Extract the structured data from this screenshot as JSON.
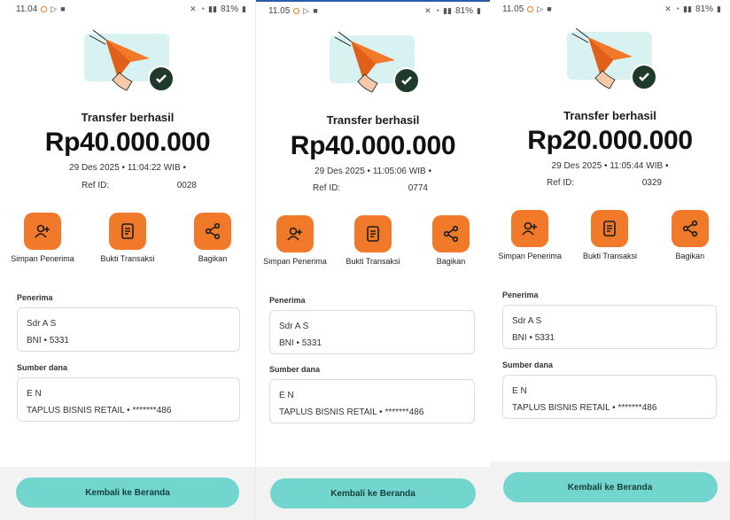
{
  "accent_color": "#f07a2a",
  "button_color": "#72d6cf",
  "screens": [
    {
      "status_time": "11.04",
      "battery": "81%",
      "title": "Transfer berhasil",
      "amount": "Rp40.000.000",
      "datetime": "29 Des 2025 • 11:04:22 WIB •",
      "ref_label": "Ref ID:",
      "ref_value": "0028",
      "actions": [
        {
          "label": "Simpan Penerima",
          "icon": "add-person-icon"
        },
        {
          "label": "Bukti Transaksi",
          "icon": "receipt-icon"
        },
        {
          "label": "Bagikan",
          "icon": "share-icon"
        }
      ],
      "recipient_label": "Penerima",
      "recipient_name": "Sdr A          S",
      "recipient_bank": "BNI •           5331",
      "source_label": "Sumber dana",
      "source_name": "E          N",
      "source_account": "TAPLUS BISNIS RETAIL • *******486",
      "home_button": "Kembali ke Beranda"
    },
    {
      "status_time": "11.05",
      "battery": "81%",
      "title": "Transfer berhasil",
      "amount": "Rp40.000.000",
      "datetime": "29 Des 2025 • 11:05:06 WIB •",
      "ref_label": "Ref ID:",
      "ref_value": "0774",
      "actions": [
        {
          "label": "Simpan Penerima",
          "icon": "add-person-icon"
        },
        {
          "label": "Bukti Transaksi",
          "icon": "receipt-icon"
        },
        {
          "label": "Bagikan",
          "icon": "share-icon"
        }
      ],
      "recipient_label": "Penerima",
      "recipient_name": "Sdr A          S",
      "recipient_bank": "BNI •           5331",
      "source_label": "Sumber dana",
      "source_name": "E          N",
      "source_account": "TAPLUS BISNIS RETAIL • *******486",
      "home_button": "Kembali ke Beranda"
    },
    {
      "status_time": "11.05",
      "battery": "81%",
      "title": "Transfer berhasil",
      "amount": "Rp20.000.000",
      "datetime": "29 Des 2025 • 11:05:44 WIB •",
      "ref_label": "Ref ID:",
      "ref_value": "0329",
      "actions": [
        {
          "label": "Simpan Penerima",
          "icon": "add-person-icon"
        },
        {
          "label": "Bukti Transaksi",
          "icon": "receipt-icon"
        },
        {
          "label": "Bagikan",
          "icon": "share-icon"
        }
      ],
      "recipient_label": "Penerima",
      "recipient_name": "Sdr A          S",
      "recipient_bank": "BNI •           5331",
      "source_label": "Sumber dana",
      "source_name": "E          N",
      "source_account": "TAPLUS BISNIS RETAIL • *******486",
      "home_button": "Kembali ke Beranda"
    }
  ]
}
